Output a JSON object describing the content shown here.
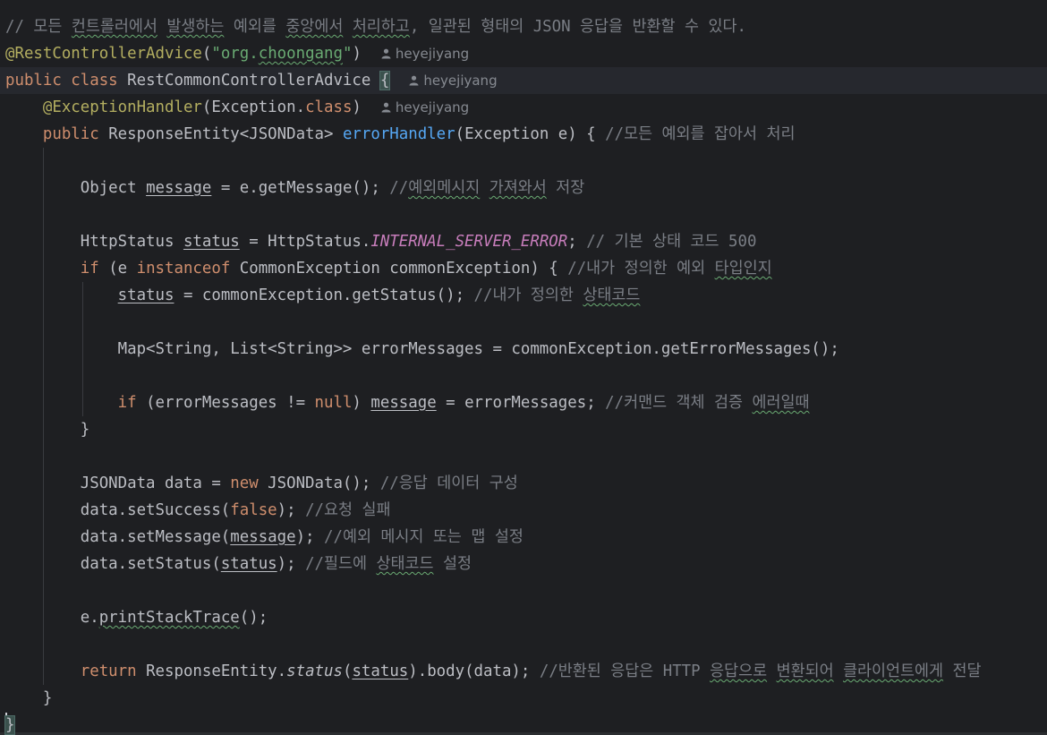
{
  "editor": {
    "lines": [
      [
        {
          "t": "// 모든 ",
          "c": "cmt"
        },
        {
          "t": "컨트롤러에서",
          "c": "cmt typo"
        },
        {
          "t": " ",
          "c": "cmt"
        },
        {
          "t": "발생하는",
          "c": "cmt typo"
        },
        {
          "t": " 예외를 ",
          "c": "cmt"
        },
        {
          "t": "중앙에서",
          "c": "cmt typo"
        },
        {
          "t": " ",
          "c": "cmt"
        },
        {
          "t": "처리하고",
          "c": "cmt typo"
        },
        {
          "t": ", 일관된 형태의 JSON 응답을 반환할 수 있다.",
          "c": "cmt"
        }
      ],
      [
        {
          "t": "@RestControllerAdvice",
          "c": "ann"
        },
        {
          "t": "(",
          "c": "punc"
        },
        {
          "t": "\"org.",
          "c": "str"
        },
        {
          "t": "choongang",
          "c": "str typo"
        },
        {
          "t": "\"",
          "c": "str"
        },
        {
          "t": ")",
          "c": "punc"
        },
        {
          "t": "heyejiyang",
          "c": "hint"
        }
      ],
      [
        {
          "t": "public ",
          "c": "kw"
        },
        {
          "t": "class ",
          "c": "kw"
        },
        {
          "t": "RestCommonControllerAdvice ",
          "c": ""
        },
        {
          "t": "{",
          "c": "brace-hl"
        },
        {
          "t": "heyejiyang",
          "c": "hint"
        }
      ],
      [
        {
          "t": "    ",
          "c": ""
        },
        {
          "t": "@ExceptionHandler",
          "c": "ann"
        },
        {
          "t": "(Exception.",
          "c": ""
        },
        {
          "t": "class",
          "c": "kw"
        },
        {
          "t": ")",
          "c": ""
        },
        {
          "t": "heyejiyang",
          "c": "hint"
        }
      ],
      [
        {
          "t": "    ",
          "c": ""
        },
        {
          "t": "public ",
          "c": "kw"
        },
        {
          "t": "ResponseEntity<JSONData> ",
          "c": ""
        },
        {
          "t": "errorHandler",
          "c": "fn"
        },
        {
          "t": "(Exception e) { ",
          "c": ""
        },
        {
          "t": "//모든 예외를 잡아서 처리",
          "c": "cmt"
        }
      ],
      [],
      [
        {
          "t": "        Object ",
          "c": ""
        },
        {
          "t": "message",
          "c": "ul"
        },
        {
          "t": " = e.getMessage(); ",
          "c": ""
        },
        {
          "t": "//",
          "c": "cmt"
        },
        {
          "t": "예외메시지",
          "c": "cmt typo"
        },
        {
          "t": " ",
          "c": "cmt"
        },
        {
          "t": "가져와서",
          "c": "cmt typo"
        },
        {
          "t": " 저장",
          "c": "cmt"
        }
      ],
      [],
      [
        {
          "t": "        HttpStatus ",
          "c": ""
        },
        {
          "t": "status",
          "c": "ul"
        },
        {
          "t": " = HttpStatus.",
          "c": ""
        },
        {
          "t": "INTERNAL_SERVER_ERROR",
          "c": "cst"
        },
        {
          "t": "; ",
          "c": ""
        },
        {
          "t": "// 기본 상태 코드 500",
          "c": "cmt"
        }
      ],
      [
        {
          "t": "        ",
          "c": ""
        },
        {
          "t": "if ",
          "c": "kw"
        },
        {
          "t": "(e ",
          "c": ""
        },
        {
          "t": "instanceof ",
          "c": "kw"
        },
        {
          "t": "CommonException commonException) { ",
          "c": ""
        },
        {
          "t": "//내가 정의한 예외 ",
          "c": "cmt"
        },
        {
          "t": "타입인지",
          "c": "cmt typo"
        }
      ],
      [
        {
          "t": "            ",
          "c": ""
        },
        {
          "t": "status",
          "c": "ul"
        },
        {
          "t": " = commonException.getStatus(); ",
          "c": ""
        },
        {
          "t": "//내가 정의한 ",
          "c": "cmt"
        },
        {
          "t": "상태코드",
          "c": "cmt typo"
        }
      ],
      [],
      [
        {
          "t": "            Map<String, List<String>> errorMessages = commonException.getErrorMessages();",
          "c": ""
        }
      ],
      [],
      [
        {
          "t": "            ",
          "c": ""
        },
        {
          "t": "if ",
          "c": "kw"
        },
        {
          "t": "(errorMessages != ",
          "c": ""
        },
        {
          "t": "null",
          "c": "kw"
        },
        {
          "t": ") ",
          "c": ""
        },
        {
          "t": "message",
          "c": "ul"
        },
        {
          "t": " = errorMessages; ",
          "c": ""
        },
        {
          "t": "//커맨드 객체 검증 ",
          "c": "cmt"
        },
        {
          "t": "에러일때",
          "c": "cmt typo"
        }
      ],
      [
        {
          "t": "        }",
          "c": ""
        }
      ],
      [],
      [
        {
          "t": "        JSONData data = ",
          "c": ""
        },
        {
          "t": "new ",
          "c": "kw"
        },
        {
          "t": "JSONData(); ",
          "c": ""
        },
        {
          "t": "//응답 데이터 구성",
          "c": "cmt"
        }
      ],
      [
        {
          "t": "        data.setSuccess(",
          "c": ""
        },
        {
          "t": "false",
          "c": "kw"
        },
        {
          "t": "); ",
          "c": ""
        },
        {
          "t": "//요청 실패",
          "c": "cmt"
        }
      ],
      [
        {
          "t": "        data.setMessage(",
          "c": ""
        },
        {
          "t": "message",
          "c": "ul"
        },
        {
          "t": "); ",
          "c": ""
        },
        {
          "t": "//예외 메시지 또는 맵 설정",
          "c": "cmt"
        }
      ],
      [
        {
          "t": "        data.setStatus(",
          "c": ""
        },
        {
          "t": "status",
          "c": "ul"
        },
        {
          "t": "); ",
          "c": ""
        },
        {
          "t": "//필드에 ",
          "c": "cmt"
        },
        {
          "t": "상태코드",
          "c": "cmt typo"
        },
        {
          "t": " 설정",
          "c": "cmt"
        }
      ],
      [],
      [
        {
          "t": "        e.",
          "c": ""
        },
        {
          "t": "printStackTrace",
          "c": "typo"
        },
        {
          "t": "();",
          "c": ""
        }
      ],
      [],
      [
        {
          "t": "        ",
          "c": ""
        },
        {
          "t": "return ",
          "c": "kw"
        },
        {
          "t": "ResponseEntity.",
          "c": ""
        },
        {
          "t": "status",
          "c": "ital"
        },
        {
          "t": "(",
          "c": ""
        },
        {
          "t": "status",
          "c": "ul"
        },
        {
          "t": ").body(data); ",
          "c": ""
        },
        {
          "t": "//반환된 응답은 HTTP ",
          "c": "cmt"
        },
        {
          "t": "응답으로",
          "c": "cmt typo"
        },
        {
          "t": " ",
          "c": "cmt"
        },
        {
          "t": "변환되어",
          "c": "cmt typo"
        },
        {
          "t": " ",
          "c": "cmt"
        },
        {
          "t": "클라이언트에게",
          "c": "cmt typo"
        },
        {
          "t": " 전달",
          "c": "cmt"
        }
      ],
      [
        {
          "t": "    }",
          "c": ""
        }
      ],
      [
        {
          "t": "}",
          "c": "brace-hl"
        }
      ]
    ],
    "current_line": 2,
    "hint_icon": "person-icon",
    "colors": {
      "background": "#1e1f22",
      "text": "#bcbec4",
      "keyword": "#cf8e6d",
      "annotation": "#b3ae60",
      "string": "#6aab73",
      "comment": "#7a7e85",
      "method": "#56a8f5",
      "constant": "#c77dbb"
    }
  }
}
